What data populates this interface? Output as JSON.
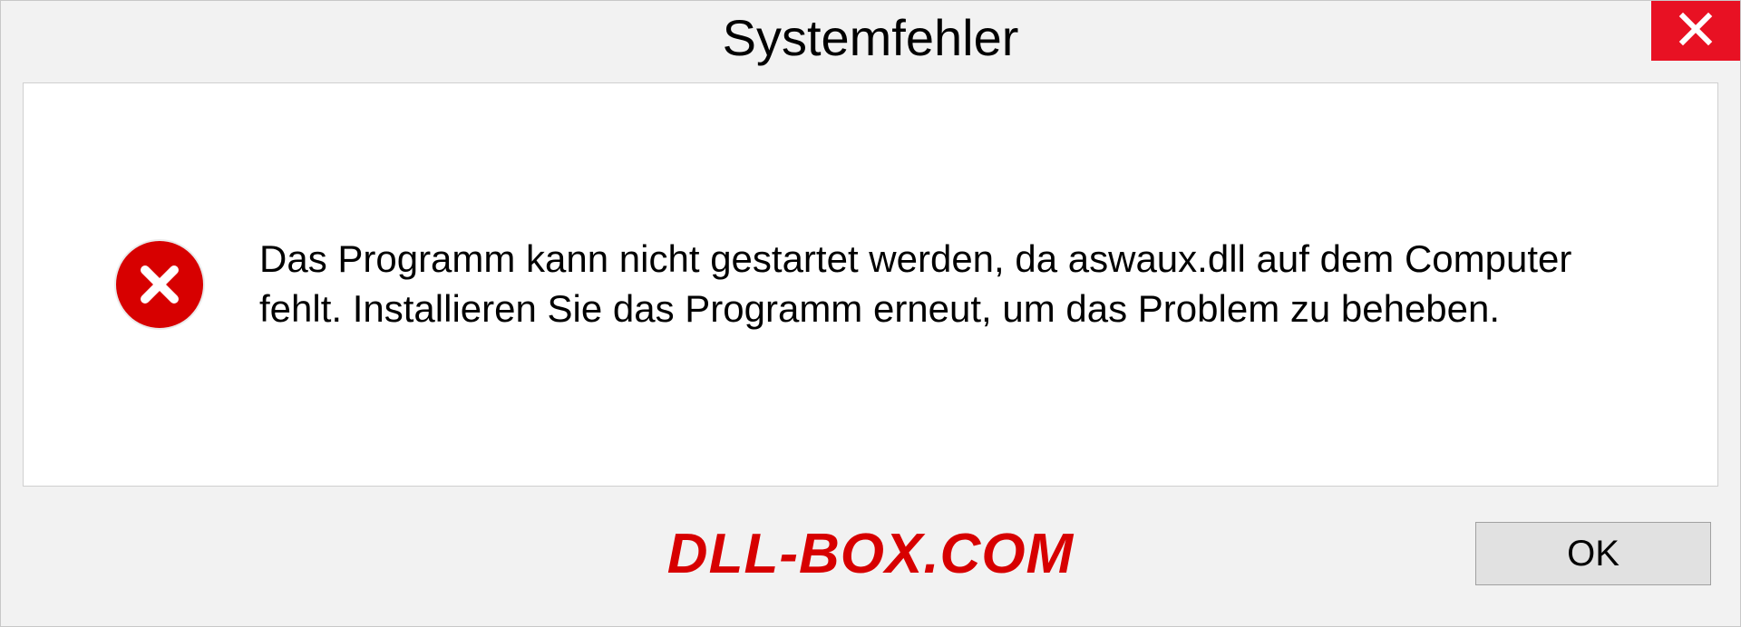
{
  "dialog": {
    "title": "Systemfehler",
    "message": "Das Programm kann nicht gestartet werden, da aswaux.dll auf dem Computer fehlt. Installieren Sie das Programm erneut, um das Problem zu beheben.",
    "ok_label": "OK",
    "watermark": "DLL-BOX.COM"
  },
  "colors": {
    "error_red": "#d70000",
    "close_red": "#e81123",
    "bg_gray": "#f2f2f2",
    "panel_white": "#ffffff"
  }
}
